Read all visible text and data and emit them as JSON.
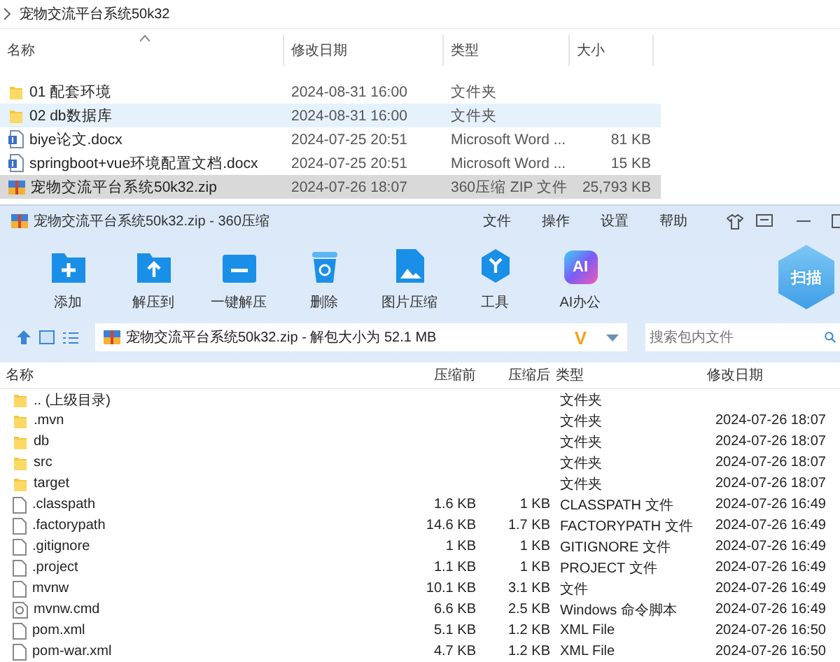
{
  "explorer": {
    "breadcrumb": "宠物交流平台系统50k32",
    "columns": [
      "名称",
      "修改日期",
      "类型",
      "大小"
    ],
    "rows": [
      {
        "kind": "folder",
        "name": "01 配套环境",
        "date": "2024-08-31 16:00",
        "type": "文件夹",
        "hovered": false,
        "selected": false
      },
      {
        "kind": "folder",
        "name": "02 db数据库",
        "date": "2024-08-31 16:00",
        "type": "文件夹",
        "hovered": true,
        "selected": false
      },
      {
        "kind": "word",
        "name": "biye论文.docx",
        "date": "2024-07-25 20:51",
        "type": "Microsoft Word ...",
        "size": "81 KB",
        "hovered": false,
        "selected": false
      },
      {
        "kind": "word",
        "name": "springboot+vue环境配置文档.docx",
        "date": "2024-07-25 20:51",
        "type": "Microsoft Word ...",
        "size": "15 KB",
        "hovered": false,
        "selected": false
      },
      {
        "kind": "zip",
        "name": "宠物交流平台系统50k32.zip",
        "date": "2024-07-26 18:07",
        "type": "360压缩 ZIP 文件",
        "size": "25,793 KB",
        "hovered": false,
        "selected": true
      }
    ]
  },
  "archiver": {
    "window": {
      "title": "宠物交流平台系统50k32.zip - 360压缩"
    },
    "menu": [
      "文件",
      "操作",
      "设置",
      "帮助"
    ],
    "toolbar": [
      {
        "kind": "add",
        "label": "添加"
      },
      {
        "kind": "extract",
        "label": "解压到"
      },
      {
        "kind": "oneclick",
        "label": "一键解压"
      },
      {
        "kind": "delete",
        "label": "删除"
      },
      {
        "kind": "image",
        "label": "图片压缩"
      },
      {
        "kind": "tools",
        "label": "工具"
      },
      {
        "kind": "ai",
        "label": "AI办公",
        "badge": "AI"
      }
    ],
    "scan_badge": "扫描",
    "address": "宠物交流平台系统50k32.zip - 解包大小为 52.1 MB",
    "address_logo": "V",
    "search": {
      "placeholder": "搜索包内文件"
    },
    "columns": [
      "名称",
      "压缩前",
      "压缩后",
      "类型",
      "修改日期"
    ],
    "rows": [
      {
        "kind": "folder",
        "name": ".. (上级目录)",
        "type": "文件夹"
      },
      {
        "kind": "folder",
        "name": ".mvn",
        "type": "文件夹",
        "date": "2024-07-26 18:07"
      },
      {
        "kind": "folder",
        "name": "db",
        "type": "文件夹",
        "date": "2024-07-26 18:07"
      },
      {
        "kind": "folder",
        "name": "src",
        "type": "文件夹",
        "date": "2024-07-26 18:07"
      },
      {
        "kind": "folder",
        "name": "target",
        "type": "文件夹",
        "date": "2024-07-26 18:07"
      },
      {
        "kind": "file",
        "name": ".classpath",
        "before": "1.6 KB",
        "after": "1 KB",
        "type": "CLASSPATH 文件",
        "date": "2024-07-26 16:49"
      },
      {
        "kind": "file",
        "name": ".factorypath",
        "before": "14.6 KB",
        "after": "1.7 KB",
        "type": "FACTORYPATH 文件",
        "date": "2024-07-26 16:49"
      },
      {
        "kind": "file",
        "name": ".gitignore",
        "before": "1 KB",
        "after": "1 KB",
        "type": "GITIGNORE 文件",
        "date": "2024-07-26 16:49"
      },
      {
        "kind": "file",
        "name": ".project",
        "before": "1.1 KB",
        "after": "1 KB",
        "type": "PROJECT 文件",
        "date": "2024-07-26 16:49"
      },
      {
        "kind": "file",
        "name": "mvnw",
        "before": "10.1 KB",
        "after": "3.1 KB",
        "type": "文件",
        "date": "2024-07-26 16:49"
      },
      {
        "kind": "script",
        "name": "mvnw.cmd",
        "before": "6.6 KB",
        "after": "2.5 KB",
        "type": "Windows 命令脚本",
        "date": "2024-07-26 16:49"
      },
      {
        "kind": "file",
        "name": "pom.xml",
        "before": "5.1 KB",
        "after": "1.2 KB",
        "type": "XML File",
        "date": "2024-07-26 16:50"
      },
      {
        "kind": "file",
        "name": "pom-war.xml",
        "before": "4.7 KB",
        "after": "1.2 KB",
        "type": "XML File",
        "date": "2024-07-26 16:50"
      }
    ]
  }
}
